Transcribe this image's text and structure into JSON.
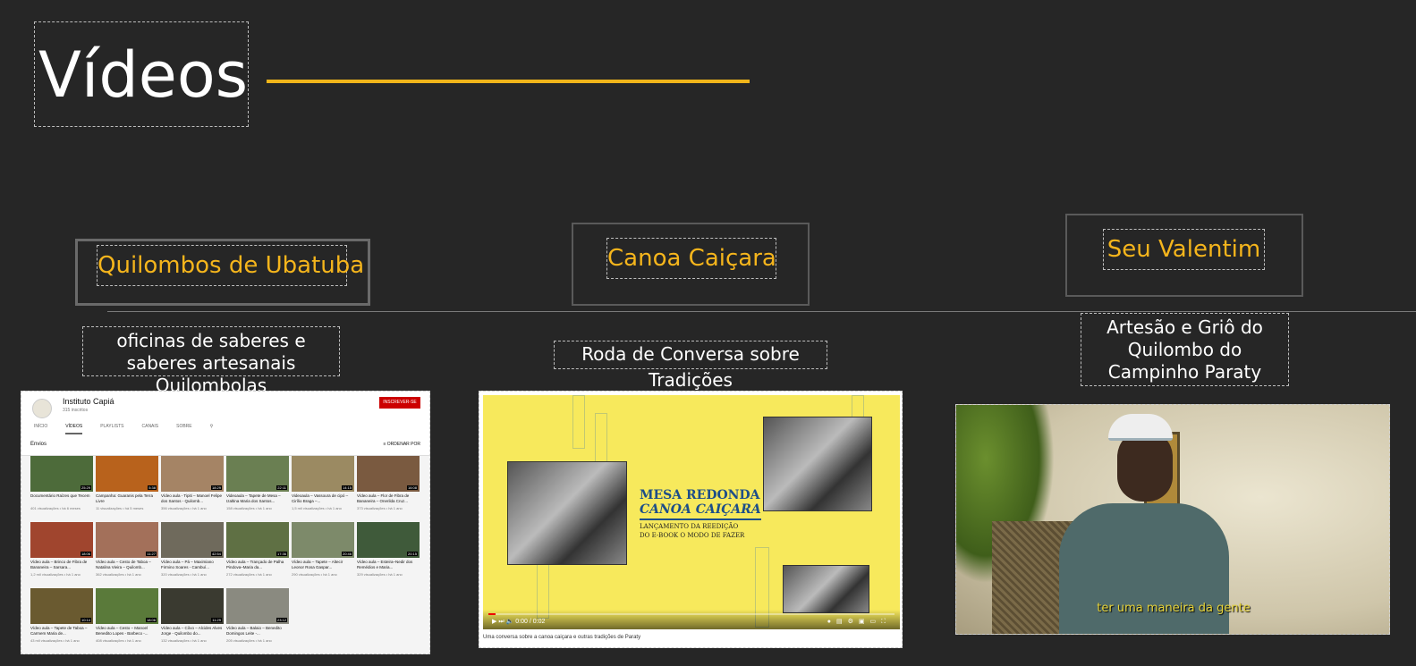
{
  "page_title": "Vídeos",
  "colors": {
    "accent": "#f0b51a",
    "background": "#262626",
    "text": "#ffffff"
  },
  "sections": [
    {
      "label": "Quilombos de Ubatuba",
      "description": "oficinas de saberes e saberes artesanais Quilombolas"
    },
    {
      "label": "Canoa Caiçara",
      "description": "Roda de Conversa sobre Tradições"
    },
    {
      "label": "Seu Valentim",
      "description": "Artesão e Griô do Quilombo do Campinho Paraty"
    }
  ],
  "youtube": {
    "channel_name": "Instituto Capiá",
    "subscribers": "315 inscritos",
    "subscribe_label": "INSCREVER-SE",
    "tabs": [
      "INÍCIO",
      "VÍDEOS",
      "PLAYLISTS",
      "CANAIS",
      "SOBRE"
    ],
    "section_title": "Envios",
    "sort_label": "ORDENAR POR",
    "videos": [
      {
        "title": "Documentário Raízes que Tecem",
        "meta": "401 visualizações • há 6 meses",
        "duration": "25:29",
        "color": "#4d6b3a"
      },
      {
        "title": "Campanha: Guaranis pela Terra Livre",
        "meta": "11 visualizações • há 5 meses",
        "duration": "5:38",
        "color": "#b8621c"
      },
      {
        "title": "Vídeo aula - Tipiti – Manoel Felipe dos Santos - Quilomb...",
        "meta": "356 visualizações • há 1 ano",
        "duration": "18:29",
        "color": "#a58465"
      },
      {
        "title": "Videoaula – Tapete de Mesa – Izaltina Maria dos Santos...",
        "meta": "158 visualizações • há 1 ano",
        "duration": "22:11",
        "color": "#6a7f52"
      },
      {
        "title": "Videoaula – Vassoura de cipó – Cirílio Braga –...",
        "meta": "1,5 mil visualizações • há 1 ano",
        "duration": "14:15",
        "color": "#9b8a62"
      },
      {
        "title": "Vídeo aula – Flor de Fibra de Bananeira – Onerilda Cruz...",
        "meta": "373 visualizações • há 1 ano",
        "duration": "16:08",
        "color": "#7a5a40"
      },
      {
        "title": "Vídeo aula – Brinco de Fibra de Bananeira – Sarsara...",
        "meta": "1,2 mil visualizações • há 1 ano",
        "duration": "18:06",
        "color": "#a0452e"
      },
      {
        "title": "Vídeo aula – Cesto de Taboa – Natalina Vieira – Quilomb...",
        "meta": "362 visualizações • há 1 ano",
        "duration": "11:27",
        "color": "#a3705a"
      },
      {
        "title": "Vídeo aula – Pá – Maximiano Firmino Soares - Cambuí...",
        "meta": "320 visualizações • há 1 ano",
        "duration": "42:54",
        "color": "#6f6a5c"
      },
      {
        "title": "Vídeo aula – Trançado de Palha Pindova–Maria da...",
        "meta": "272 visualizações • há 1 ano",
        "duration": "17:36",
        "color": "#5f7044"
      },
      {
        "title": "Vídeo aula – Tapete – Altecir Leonor Rosa Gaspar...",
        "meta": "290 visualizações • há 1 ano",
        "duration": "20:46",
        "color": "#7d8a6a"
      },
      {
        "title": "Vídeo aula – Esteira–Nedir dos Remédios e Maria...",
        "meta": "329 visualizações • há 1 ano",
        "duration": "20:15",
        "color": "#3f5a3a"
      },
      {
        "title": "Vídeo aula – Tapete de Taboa – Carmem Maria de...",
        "meta": "43 mil visualizações • há 1 ano",
        "duration": "10:14",
        "color": "#6a5a30"
      },
      {
        "title": "Vídeo aula – Cesto – Manoel Benedito Lopes - Barbeco -...",
        "meta": "408 visualizações • há 1 ano",
        "duration": "18:06",
        "color": "#5a7a3a"
      },
      {
        "title": "Vídeo aula – Côvo – Alcides Alves Jorge - Quilombo do...",
        "meta": "132 visualizações • há 1 ano",
        "duration": "11:29",
        "color": "#3a3a30"
      },
      {
        "title": "Vídeo aula – Balaio – Benedito Domingos Leite -...",
        "meta": "205 visualizações • há 1 ano",
        "duration": "23:12",
        "color": "#8a8a80"
      }
    ]
  },
  "canoa_video": {
    "heading_1": "MESA REDONDA",
    "heading_2": "CANOA CAIÇARA",
    "subheading_1": "LANÇAMENTO DA REEDIÇÃO",
    "subheading_2": "DO E-BOOK  O MODO DE FAZER",
    "time": "0:00 / 0:02",
    "caption": "Uma conversa sobre a canoa caiçara e outras tradições de Paraty"
  },
  "valentim_video": {
    "subtitle": "ter uma maneira da gente"
  }
}
